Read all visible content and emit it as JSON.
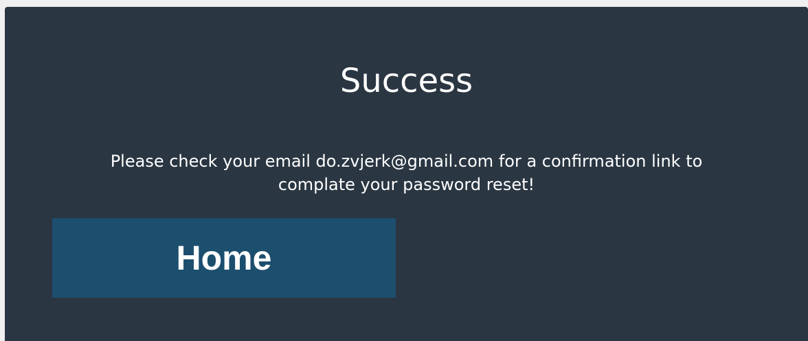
{
  "dialog": {
    "title": "Success",
    "message_line1": "Please check your email do.zvjerk@gmail.com for a confirmation link to",
    "message_line2": "complate your password reset!",
    "home_button_label": "Home"
  },
  "colors": {
    "panel_background": "#2a3642",
    "button_background": "#1c4e6e",
    "text": "#ffffff"
  }
}
